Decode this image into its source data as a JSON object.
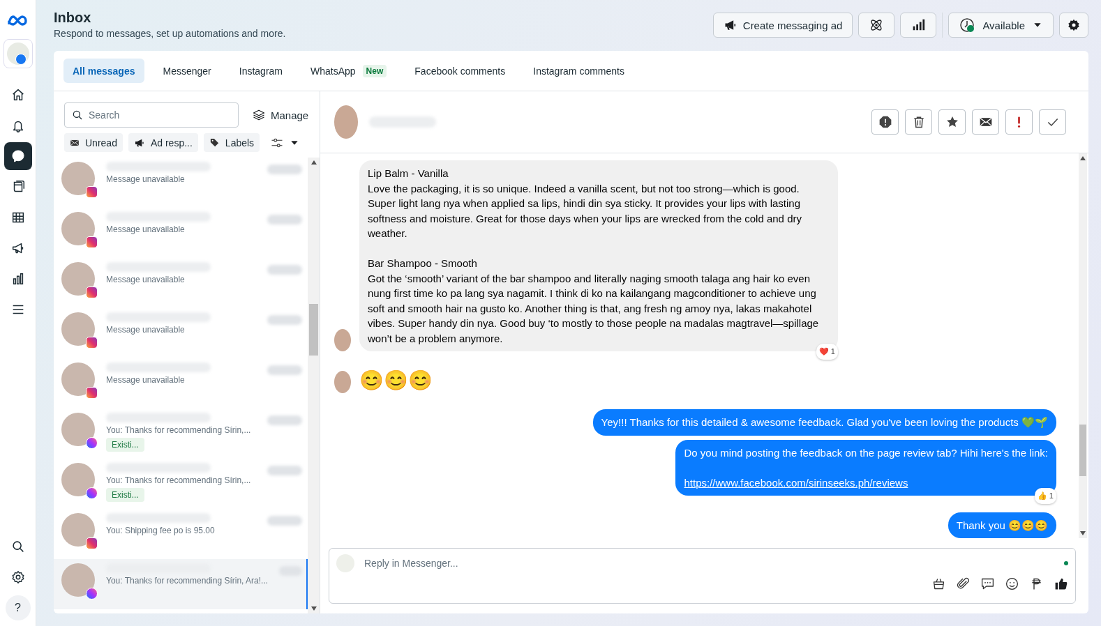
{
  "rail": {
    "nav": [
      {
        "kind": "home",
        "selected": false
      },
      {
        "kind": "bell",
        "selected": false
      },
      {
        "kind": "chat",
        "selected": true
      },
      {
        "kind": "pages",
        "selected": false
      },
      {
        "kind": "table",
        "selected": false
      },
      {
        "kind": "megaphone",
        "selected": false
      },
      {
        "kind": "chart",
        "selected": false
      },
      {
        "kind": "menu",
        "selected": false
      }
    ],
    "bottom": [
      {
        "kind": "search"
      },
      {
        "kind": "settings"
      },
      {
        "kind": "help",
        "label": "?"
      }
    ]
  },
  "header": {
    "title": "Inbox",
    "subtitle": "Respond to messages, set up automations and more.",
    "actions": [
      {
        "kind": "ad",
        "label": "Create messaging ad"
      },
      {
        "kind": "atom"
      },
      {
        "kind": "chart"
      },
      {
        "kind": "status",
        "label": "Available"
      },
      {
        "kind": "settings"
      }
    ]
  },
  "tabs": [
    {
      "label": "All messages",
      "selected": true
    },
    {
      "label": "Messenger",
      "selected": false
    },
    {
      "label": "Instagram",
      "selected": false
    },
    {
      "label": "WhatsApp",
      "badge": "New",
      "selected": false
    },
    {
      "label": "Facebook comments",
      "selected": false
    },
    {
      "label": "Instagram comments",
      "selected": false
    }
  ],
  "list": {
    "search": {
      "placeholder": "Search"
    },
    "manage": "Manage",
    "filters": [
      {
        "kind": "unread",
        "label": "Unread"
      },
      {
        "kind": "ad",
        "label": "Ad resp..."
      },
      {
        "kind": "labels",
        "label": "Labels"
      },
      {
        "kind": "settings"
      }
    ],
    "conversations": [
      {
        "kind": "instagram",
        "preview": "Message unavailable",
        "selected": false
      },
      {
        "kind": "instagram",
        "preview": "Message unavailable",
        "selected": false
      },
      {
        "kind": "instagram",
        "preview": "Message unavailable",
        "selected": false
      },
      {
        "kind": "instagram",
        "preview": "Message unavailable",
        "selected": false
      },
      {
        "kind": "instagram",
        "preview": "Message unavailable",
        "selected": false
      },
      {
        "kind": "messenger",
        "preview": "You: Thanks for recommending Sírin,...",
        "tag": "Existi...",
        "selected": false
      },
      {
        "kind": "messenger",
        "preview": "You: Thanks for recommending Sírin,...",
        "tag": "Existi...",
        "selected": false
      },
      {
        "kind": "instagram",
        "preview": "You: Shipping fee po is 95.00",
        "selected": false
      },
      {
        "kind": "messenger",
        "preview": "You: Thanks for recommending Sírin, Ara!...",
        "selected": true
      }
    ]
  },
  "chat": {
    "actions": [
      {
        "kind": "spam"
      },
      {
        "kind": "trash"
      },
      {
        "kind": "star"
      },
      {
        "kind": "mail"
      },
      {
        "kind": "alert"
      },
      {
        "kind": "check"
      }
    ],
    "messages": [
      {
        "kind": "incoming",
        "text": "Lip Balm - Vanilla\nLove the packaging, it is so unique. Indeed a vanilla scent, but not too strong—which is good. Super light lang nya when applied sa lips, hindi din sya sticky. It provides your lips with lasting softness and moisture. Great for those days when your lips are wrecked from the cold and dry weather.\n\nBar Shampoo - Smooth\nGot the ‘smooth’ variant of the bar shampoo and literally naging smooth talaga ang hair ko even nung first time ko pa lang sya nagamit. I think di ko na kailangang magconditioner to achieve ung soft and smooth hair na gusto ko. Another thing is that, ang fresh ng amoy nya, lakas makahotel vibes. Super handy din nya. Good buy ‘to mostly to those people na madalas magtravel—spillage won’t be a problem anymore.",
        "reaction": {
          "emoji": "❤️",
          "count": "1"
        }
      },
      {
        "kind": "incoming-emoji",
        "text": "😊😊😊"
      },
      {
        "kind": "outgoing",
        "text": "Yey!!! Thanks for this detailed & awesome feedback. Glad you've been loving the products 💚🌱"
      },
      {
        "kind": "outgoing",
        "text": "Do you mind posting the feedback on the page review tab? Hihi here's the link:",
        "link": "https://www.facebook.com/sirinseeks.ph/reviews",
        "reaction": {
          "emoji": "👍",
          "count": "1"
        }
      },
      {
        "kind": "outgoing",
        "text": "Thank you 😊😊😊"
      }
    ],
    "composer": {
      "placeholder": "Reply in Messenger...",
      "tools": [
        {
          "kind": "bag"
        },
        {
          "kind": "clip"
        },
        {
          "kind": "bubble"
        },
        {
          "kind": "smile"
        },
        {
          "kind": "peso"
        },
        {
          "kind": "thumb"
        }
      ]
    }
  }
}
